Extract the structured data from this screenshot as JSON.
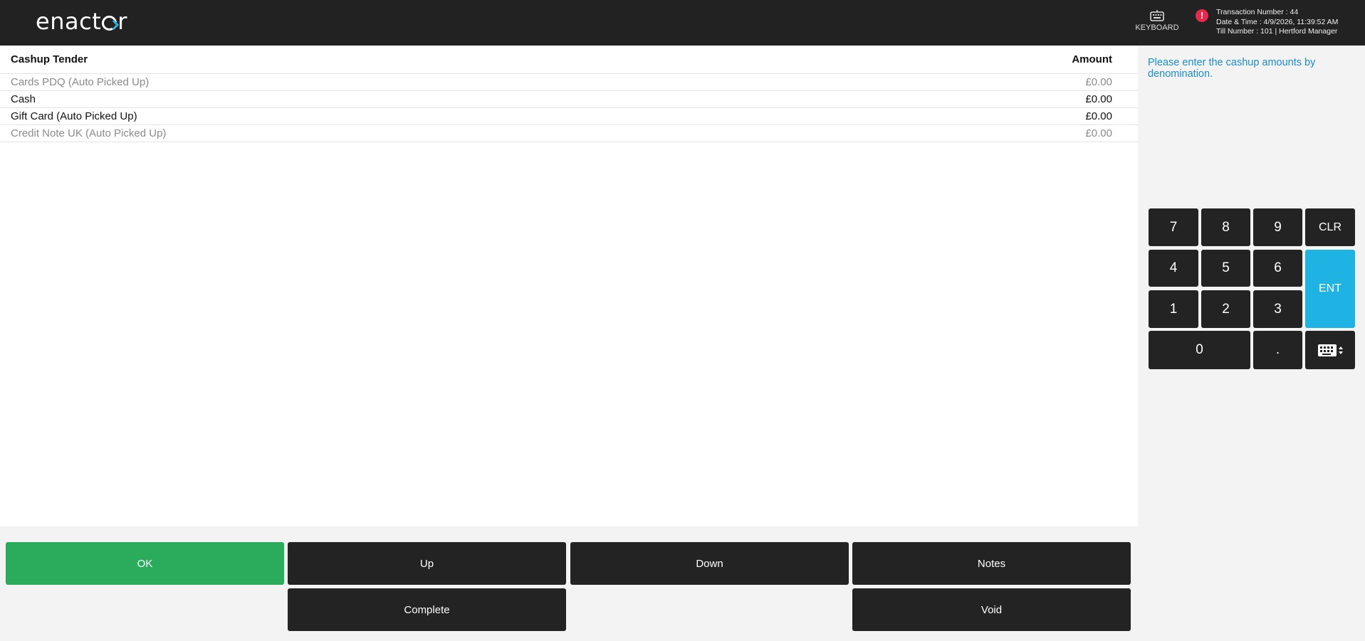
{
  "header": {
    "logo_text": [
      "en",
      "act",
      "r"
    ],
    "keyboard_label": "KEYBOARD",
    "transaction_number": "Transaction Number : 44",
    "date_time": "Date & Time : 4/9/2026, 11:39:52 AM",
    "till_info": "Till Number : 101 | Hertford Manager",
    "alert_symbol": "!"
  },
  "table": {
    "col_tender": "Cashup Tender",
    "col_amount": "Amount",
    "rows": [
      {
        "name": "Cards PDQ (Auto Picked Up)",
        "amount": "£0.00",
        "state": "muted"
      },
      {
        "name": "Cash",
        "amount": "£0.00",
        "state": "active"
      },
      {
        "name": "Gift Card (Auto Picked Up)",
        "amount": "£0.00",
        "state": "active"
      },
      {
        "name": "Credit Note UK (Auto Picked Up)",
        "amount": "£0.00",
        "state": "muted"
      }
    ]
  },
  "prompt": "Please enter the cashup amounts by denomination.",
  "keypad": {
    "k7": "7",
    "k8": "8",
    "k9": "9",
    "clr": "CLR",
    "k4": "4",
    "k5": "5",
    "k6": "6",
    "ent": "ENT",
    "k1": "1",
    "k2": "2",
    "k3": "3",
    "k0": "0",
    "dot": "."
  },
  "buttons": {
    "ok": "OK",
    "up": "Up",
    "down": "Down",
    "notes": "Notes",
    "complete": "Complete",
    "void": "Void"
  },
  "colors": {
    "header_bg": "#222222",
    "ok_green": "#2aac5c",
    "ent_blue": "#1fb3e3",
    "prompt_blue": "#1a8cc8",
    "alert_red": "#e8294c"
  },
  "icons": [
    "keyboard-icon",
    "alert-icon",
    "keyboard-toggle-icon"
  ]
}
